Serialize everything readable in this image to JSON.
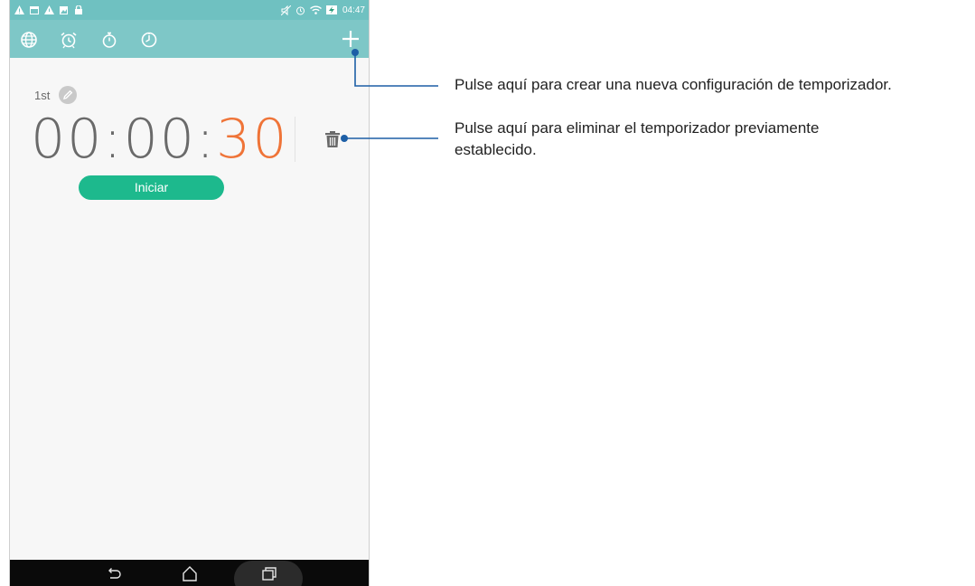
{
  "status_bar": {
    "time": "04:47"
  },
  "toolbar": {
    "tabs": [
      {
        "name": "world-clock",
        "icon": "globe-icon"
      },
      {
        "name": "alarm",
        "icon": "alarm-clock-icon"
      },
      {
        "name": "stopwatch",
        "icon": "stopwatch-icon"
      },
      {
        "name": "timer",
        "icon": "timer-icon"
      }
    ],
    "add_icon": "plus-icon"
  },
  "timer": {
    "name": "1st",
    "hours": "00",
    "minutes": "00",
    "seconds": "30",
    "sep1": ":",
    "sep2": ":",
    "start_label": "Iniciar"
  },
  "callouts": {
    "add": "Pulse aquí para crear una nueva configuración de temporizador.",
    "delete_line1": "Pulse aquí para eliminar el temporizador previamente",
    "delete_line2": "establecido."
  },
  "colors": {
    "toolbar": "#7ec7c7",
    "accent_seconds": "#ef7438",
    "start_button": "#1db98d",
    "callout_line": "#1d5fa6"
  }
}
